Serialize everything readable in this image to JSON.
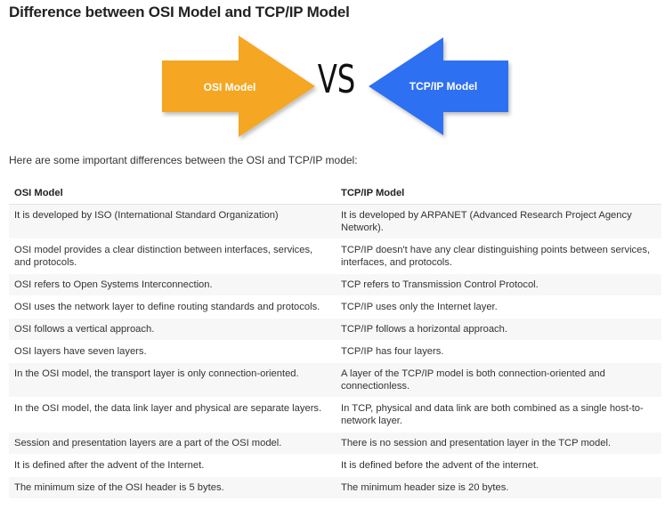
{
  "title": "Difference between OSI Model and TCP/IP Model",
  "banner": {
    "left_label": "OSI Model",
    "vs_label": "VS",
    "right_label": "TCP/IP Model",
    "colors": {
      "left_arrow": "#f5a623",
      "right_arrow": "#2f6ff2",
      "vs_text": "#111111"
    }
  },
  "intro": "Here are some important differences between the OSI and TCP/IP model:",
  "table": {
    "headers": [
      "OSI Model",
      "TCP/IP Model"
    ],
    "rows": [
      [
        "It is developed by ISO (International Standard Organization)",
        "It is developed by ARPANET (Advanced Research Project Agency Network)."
      ],
      [
        "OSI model provides a clear distinction between interfaces, services, and protocols.",
        "TCP/IP doesn't have any clear distinguishing points between services, interfaces, and protocols."
      ],
      [
        "OSI refers to Open Systems Interconnection.",
        "TCP refers to Transmission Control Protocol."
      ],
      [
        "OSI uses the network layer to define routing standards and protocols.",
        "TCP/IP uses only the Internet layer."
      ],
      [
        "OSI follows a vertical approach.",
        "TCP/IP follows a horizontal approach."
      ],
      [
        "OSI layers have seven layers.",
        "TCP/IP has four layers."
      ],
      [
        "In the OSI model, the transport layer is only connection-oriented.",
        "A layer of the TCP/IP model is both connection-oriented and connectionless."
      ],
      [
        "In the OSI model, the data link layer and physical are separate layers.",
        "In TCP, physical and data link are both combined as a single host-to-network layer."
      ],
      [
        "Session and presentation layers are a part of the OSI model.",
        "There is no session and presentation layer in the TCP model."
      ],
      [
        "It is defined after the advent of the Internet.",
        "It is defined before the advent of the internet."
      ],
      [
        "The minimum size of the OSI header is 5 bytes.",
        "The minimum header size is 20 bytes."
      ]
    ]
  }
}
